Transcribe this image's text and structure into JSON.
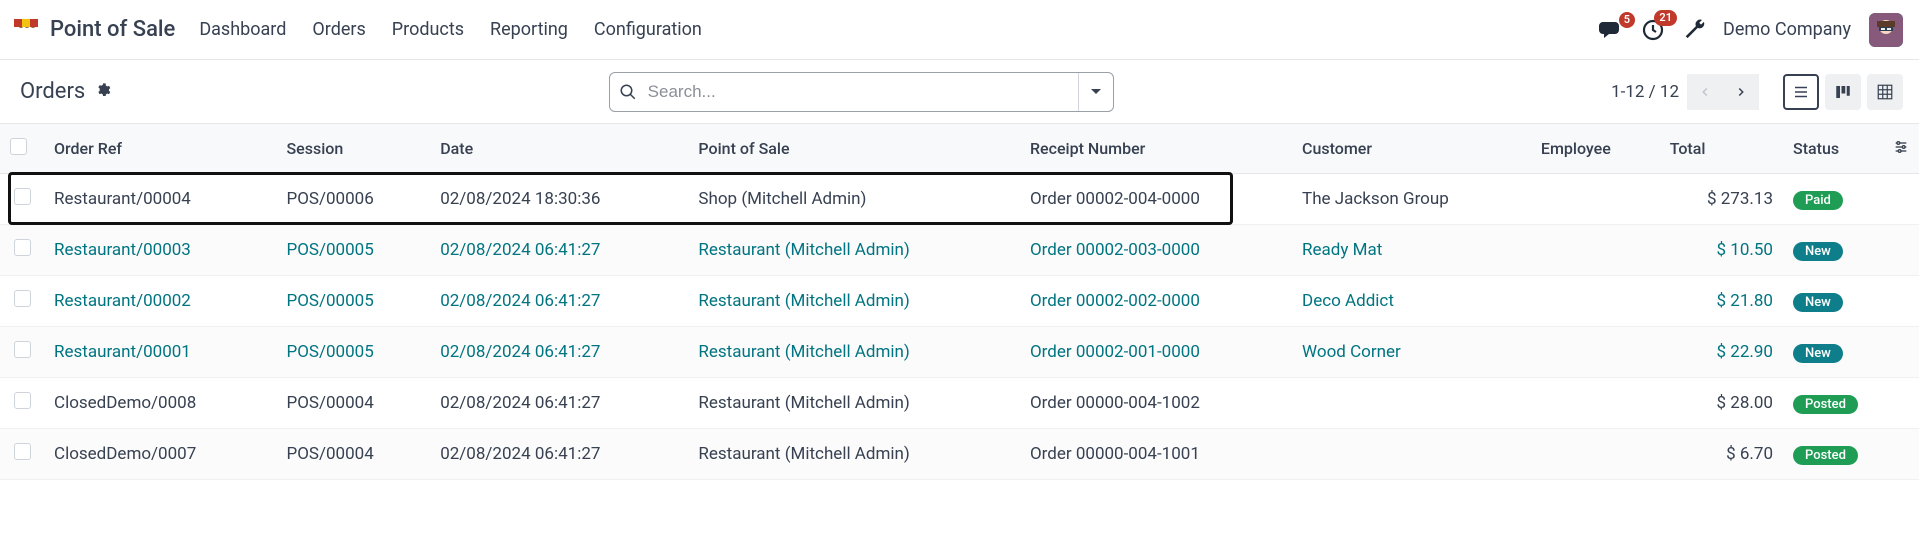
{
  "brand": {
    "title": "Point of Sale"
  },
  "nav": [
    "Dashboard",
    "Orders",
    "Products",
    "Reporting",
    "Configuration"
  ],
  "company": "Demo Company",
  "badges": {
    "messages": "5",
    "activities": "21"
  },
  "page": {
    "title": "Orders"
  },
  "search": {
    "placeholder": "Search..."
  },
  "pager": {
    "text": "1-12 / 12"
  },
  "table": {
    "headers": {
      "orderRef": "Order Ref",
      "session": "Session",
      "date": "Date",
      "pos": "Point of Sale",
      "receipt": "Receipt Number",
      "customer": "Customer",
      "employee": "Employee",
      "total": "Total",
      "status": "Status"
    },
    "rows": [
      {
        "orderRef": "Restaurant/00004",
        "session": "POS/00006",
        "date": "02/08/2024 18:30:36",
        "pos": "Shop (Mitchell Admin)",
        "receipt": "Order 00002-004-0000",
        "customer": "The Jackson Group",
        "employee": "",
        "total": "$ 273.13",
        "status": "Paid",
        "statusClass": "status-paid",
        "link": false,
        "highlight": true
      },
      {
        "orderRef": "Restaurant/00003",
        "session": "POS/00005",
        "date": "02/08/2024 06:41:27",
        "pos": "Restaurant (Mitchell Admin)",
        "receipt": "Order 00002-003-0000",
        "customer": "Ready Mat",
        "employee": "",
        "total": "$ 10.50",
        "status": "New",
        "statusClass": "status-new",
        "link": true
      },
      {
        "orderRef": "Restaurant/00002",
        "session": "POS/00005",
        "date": "02/08/2024 06:41:27",
        "pos": "Restaurant (Mitchell Admin)",
        "receipt": "Order 00002-002-0000",
        "customer": "Deco Addict",
        "employee": "",
        "total": "$ 21.80",
        "status": "New",
        "statusClass": "status-new",
        "link": true
      },
      {
        "orderRef": "Restaurant/00001",
        "session": "POS/00005",
        "date": "02/08/2024 06:41:27",
        "pos": "Restaurant (Mitchell Admin)",
        "receipt": "Order 00002-001-0000",
        "customer": "Wood Corner",
        "employee": "",
        "total": "$ 22.90",
        "status": "New",
        "statusClass": "status-new",
        "link": true
      },
      {
        "orderRef": "ClosedDemo/0008",
        "session": "POS/00004",
        "date": "02/08/2024 06:41:27",
        "pos": "Restaurant (Mitchell Admin)",
        "receipt": "Order 00000-004-1002",
        "customer": "",
        "employee": "",
        "total": "$ 28.00",
        "status": "Posted",
        "statusClass": "status-posted",
        "link": false
      },
      {
        "orderRef": "ClosedDemo/0007",
        "session": "POS/00004",
        "date": "02/08/2024 06:41:27",
        "pos": "Restaurant (Mitchell Admin)",
        "receipt": "Order 00000-004-1001",
        "customer": "",
        "employee": "",
        "total": "$ 6.70",
        "status": "Posted",
        "statusClass": "status-posted",
        "link": false
      }
    ]
  }
}
